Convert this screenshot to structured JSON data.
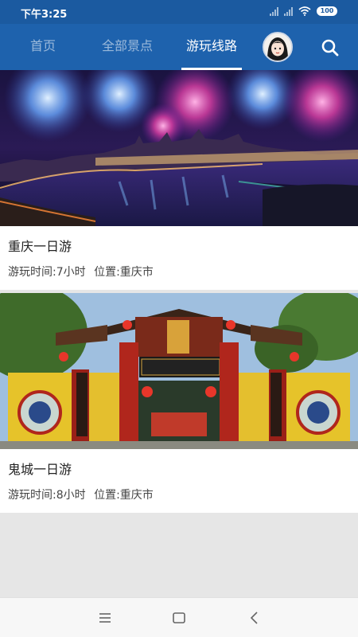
{
  "status_bar": {
    "time": "下午3:25",
    "battery": "100",
    "icons": [
      "signal-icon",
      "signal-icon",
      "wifi-icon",
      "battery-icon"
    ]
  },
  "header": {
    "tabs": [
      {
        "label": "首页",
        "active": false
      },
      {
        "label": "全部景点",
        "active": false
      },
      {
        "label": "游玩线路",
        "active": true
      }
    ],
    "icons": [
      "avatar",
      "search-icon"
    ]
  },
  "routes": [
    {
      "title": "重庆一日游",
      "duration": "游玩时间:7小时",
      "location": "位置:重庆市",
      "image": "night-city-fireworks-photo"
    },
    {
      "title": "鬼城一日游",
      "duration": "游玩时间:8小时",
      "location": "位置:重庆市",
      "image": "ghost-city-gate-photo"
    }
  ],
  "nav_bar": {
    "icons": [
      "menu-icon",
      "home-icon",
      "back-icon"
    ]
  },
  "colors": {
    "header_bg": "#1e62ad",
    "status_bg": "#1b5aa0",
    "page_bg": "#e6e6e6"
  }
}
